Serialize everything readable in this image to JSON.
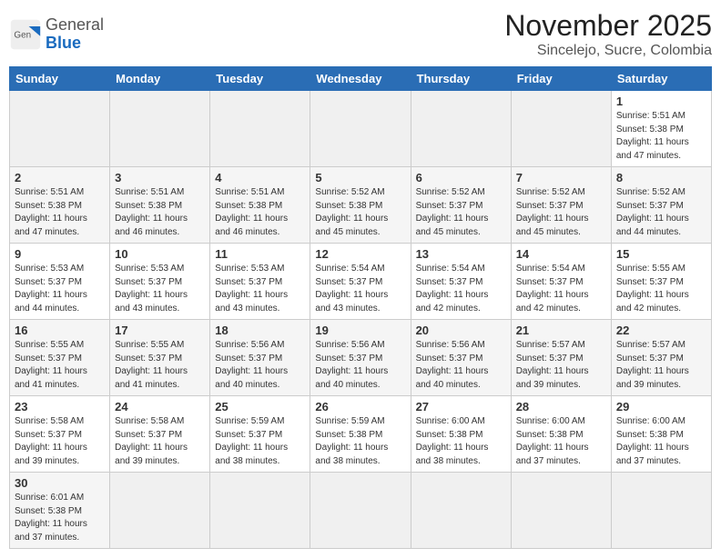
{
  "header": {
    "logo_general": "General",
    "logo_blue": "Blue",
    "month_title": "November 2025",
    "subtitle": "Sincelejo, Sucre, Colombia"
  },
  "calendar": {
    "days_of_week": [
      "Sunday",
      "Monday",
      "Tuesday",
      "Wednesday",
      "Thursday",
      "Friday",
      "Saturday"
    ],
    "weeks": [
      [
        {
          "day": "",
          "info": ""
        },
        {
          "day": "",
          "info": ""
        },
        {
          "day": "",
          "info": ""
        },
        {
          "day": "",
          "info": ""
        },
        {
          "day": "",
          "info": ""
        },
        {
          "day": "",
          "info": ""
        },
        {
          "day": "1",
          "info": "Sunrise: 5:51 AM\nSunset: 5:38 PM\nDaylight: 11 hours\nand 47 minutes."
        }
      ],
      [
        {
          "day": "2",
          "info": "Sunrise: 5:51 AM\nSunset: 5:38 PM\nDaylight: 11 hours\nand 47 minutes."
        },
        {
          "day": "3",
          "info": "Sunrise: 5:51 AM\nSunset: 5:38 PM\nDaylight: 11 hours\nand 46 minutes."
        },
        {
          "day": "4",
          "info": "Sunrise: 5:51 AM\nSunset: 5:38 PM\nDaylight: 11 hours\nand 46 minutes."
        },
        {
          "day": "5",
          "info": "Sunrise: 5:52 AM\nSunset: 5:38 PM\nDaylight: 11 hours\nand 45 minutes."
        },
        {
          "day": "6",
          "info": "Sunrise: 5:52 AM\nSunset: 5:37 PM\nDaylight: 11 hours\nand 45 minutes."
        },
        {
          "day": "7",
          "info": "Sunrise: 5:52 AM\nSunset: 5:37 PM\nDaylight: 11 hours\nand 45 minutes."
        },
        {
          "day": "8",
          "info": "Sunrise: 5:52 AM\nSunset: 5:37 PM\nDaylight: 11 hours\nand 44 minutes."
        }
      ],
      [
        {
          "day": "9",
          "info": "Sunrise: 5:53 AM\nSunset: 5:37 PM\nDaylight: 11 hours\nand 44 minutes."
        },
        {
          "day": "10",
          "info": "Sunrise: 5:53 AM\nSunset: 5:37 PM\nDaylight: 11 hours\nand 43 minutes."
        },
        {
          "day": "11",
          "info": "Sunrise: 5:53 AM\nSunset: 5:37 PM\nDaylight: 11 hours\nand 43 minutes."
        },
        {
          "day": "12",
          "info": "Sunrise: 5:54 AM\nSunset: 5:37 PM\nDaylight: 11 hours\nand 43 minutes."
        },
        {
          "day": "13",
          "info": "Sunrise: 5:54 AM\nSunset: 5:37 PM\nDaylight: 11 hours\nand 42 minutes."
        },
        {
          "day": "14",
          "info": "Sunrise: 5:54 AM\nSunset: 5:37 PM\nDaylight: 11 hours\nand 42 minutes."
        },
        {
          "day": "15",
          "info": "Sunrise: 5:55 AM\nSunset: 5:37 PM\nDaylight: 11 hours\nand 42 minutes."
        }
      ],
      [
        {
          "day": "16",
          "info": "Sunrise: 5:55 AM\nSunset: 5:37 PM\nDaylight: 11 hours\nand 41 minutes."
        },
        {
          "day": "17",
          "info": "Sunrise: 5:55 AM\nSunset: 5:37 PM\nDaylight: 11 hours\nand 41 minutes."
        },
        {
          "day": "18",
          "info": "Sunrise: 5:56 AM\nSunset: 5:37 PM\nDaylight: 11 hours\nand 40 minutes."
        },
        {
          "day": "19",
          "info": "Sunrise: 5:56 AM\nSunset: 5:37 PM\nDaylight: 11 hours\nand 40 minutes."
        },
        {
          "day": "20",
          "info": "Sunrise: 5:56 AM\nSunset: 5:37 PM\nDaylight: 11 hours\nand 40 minutes."
        },
        {
          "day": "21",
          "info": "Sunrise: 5:57 AM\nSunset: 5:37 PM\nDaylight: 11 hours\nand 39 minutes."
        },
        {
          "day": "22",
          "info": "Sunrise: 5:57 AM\nSunset: 5:37 PM\nDaylight: 11 hours\nand 39 minutes."
        }
      ],
      [
        {
          "day": "23",
          "info": "Sunrise: 5:58 AM\nSunset: 5:37 PM\nDaylight: 11 hours\nand 39 minutes."
        },
        {
          "day": "24",
          "info": "Sunrise: 5:58 AM\nSunset: 5:37 PM\nDaylight: 11 hours\nand 39 minutes."
        },
        {
          "day": "25",
          "info": "Sunrise: 5:59 AM\nSunset: 5:37 PM\nDaylight: 11 hours\nand 38 minutes."
        },
        {
          "day": "26",
          "info": "Sunrise: 5:59 AM\nSunset: 5:38 PM\nDaylight: 11 hours\nand 38 minutes."
        },
        {
          "day": "27",
          "info": "Sunrise: 6:00 AM\nSunset: 5:38 PM\nDaylight: 11 hours\nand 38 minutes."
        },
        {
          "day": "28",
          "info": "Sunrise: 6:00 AM\nSunset: 5:38 PM\nDaylight: 11 hours\nand 37 minutes."
        },
        {
          "day": "29",
          "info": "Sunrise: 6:00 AM\nSunset: 5:38 PM\nDaylight: 11 hours\nand 37 minutes."
        }
      ],
      [
        {
          "day": "30",
          "info": "Sunrise: 6:01 AM\nSunset: 5:38 PM\nDaylight: 11 hours\nand 37 minutes."
        },
        {
          "day": "",
          "info": ""
        },
        {
          "day": "",
          "info": ""
        },
        {
          "day": "",
          "info": ""
        },
        {
          "day": "",
          "info": ""
        },
        {
          "day": "",
          "info": ""
        },
        {
          "day": "",
          "info": ""
        }
      ]
    ]
  }
}
